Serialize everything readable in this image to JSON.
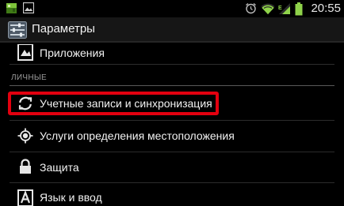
{
  "status_bar": {
    "time": "20:55",
    "left_icons": [
      "android-robot-icon",
      "image-icon"
    ],
    "right_icons": [
      "alarm-icon",
      "wifi-icon",
      "signal-icon",
      "battery-icon"
    ]
  },
  "action_bar": {
    "title": "Параметры",
    "icon": "settings-app-icon"
  },
  "list": {
    "apps_label": "Приложения",
    "section_personal": "ЛИЧНЫЕ",
    "accounts_label": "Учетные записи и синхронизация",
    "location_label": "Услуги определения местоположения",
    "security_label": "Защита",
    "language_label": "Язык и ввод"
  },
  "colors": {
    "highlight": "#e3000f",
    "background": "#000000",
    "status_icon_green": "#8fd24a"
  }
}
